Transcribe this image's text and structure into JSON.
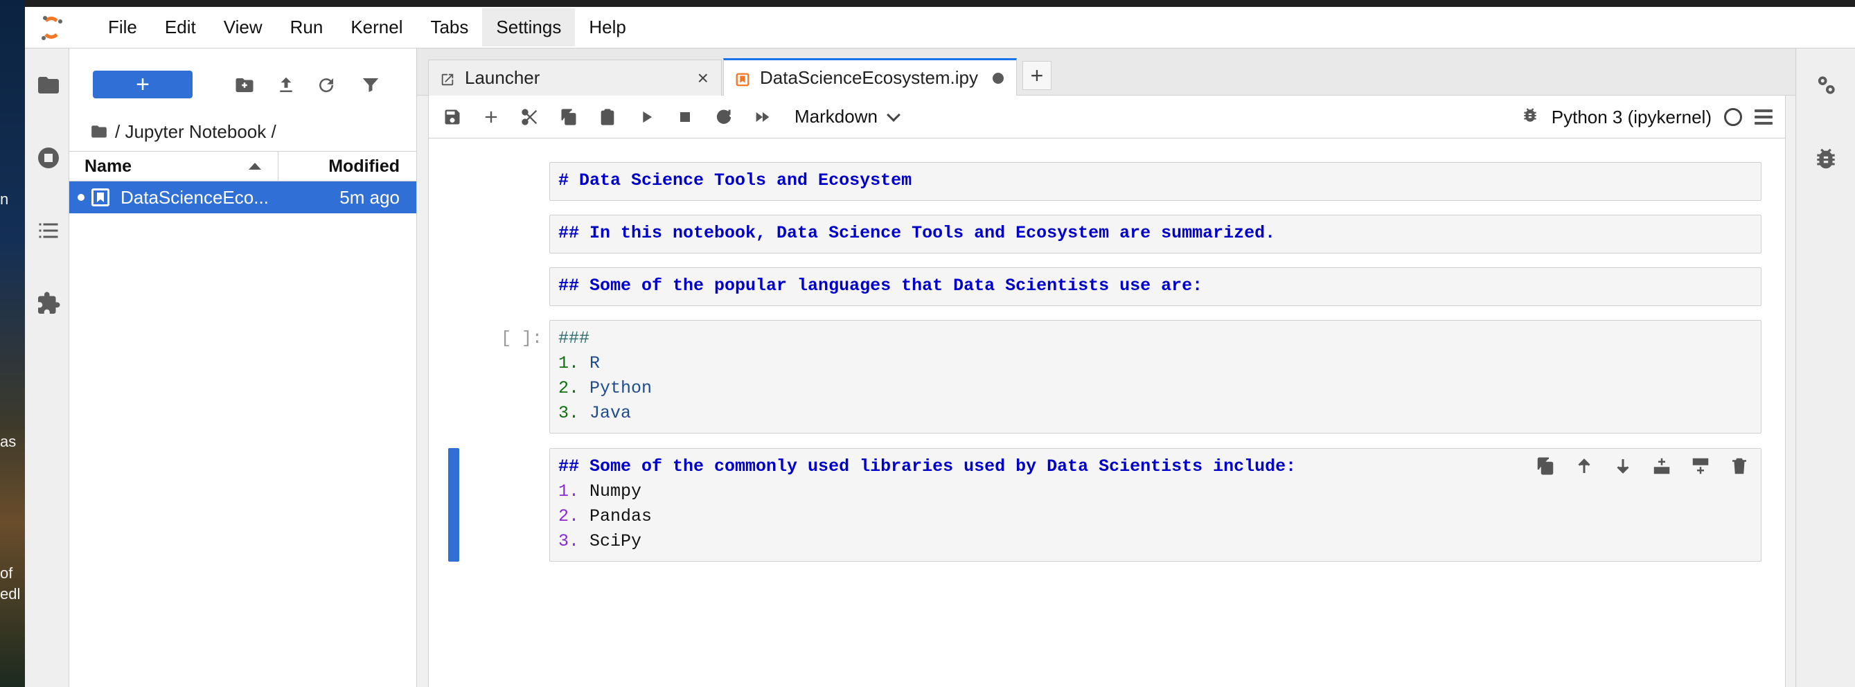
{
  "desktop": {
    "texts": [
      "n",
      "as",
      "of",
      "edl"
    ]
  },
  "menubar": {
    "items": [
      "File",
      "Edit",
      "View",
      "Run",
      "Kernel",
      "Tabs",
      "Settings",
      "Help"
    ],
    "active_item": "Settings"
  },
  "left_sidebar": {
    "icons": [
      "folder-icon",
      "running-icon",
      "table-of-contents-icon",
      "extensions-icon"
    ]
  },
  "filebrowser": {
    "new_button_label": "+",
    "breadcrumb": "/ Jupyter Notebook /",
    "columns": {
      "name": "Name",
      "modified": "Modified"
    },
    "files": [
      {
        "name": "DataScienceEco...",
        "modified": "5m ago",
        "selected": true,
        "running": true
      }
    ]
  },
  "tabs": [
    {
      "label": "Launcher",
      "closable": true
    },
    {
      "label": "DataScienceEcosystem.ipy",
      "dirty": true,
      "active": true
    }
  ],
  "notebook_toolbar": {
    "cell_type": "Markdown",
    "kernel_name": "Python 3 (ipykernel)"
  },
  "cells": [
    {
      "type": "markdown",
      "text": "# Data Science Tools and Ecosystem"
    },
    {
      "type": "markdown",
      "text": "## In this notebook, Data Science Tools and Ecosystem are summarized."
    },
    {
      "type": "markdown",
      "text": "## Some of the popular languages that Data Scientists use are:"
    },
    {
      "type": "code",
      "prompt": "[ ]:",
      "lines": [
        {
          "prefix": "###",
          "text": ""
        },
        {
          "prefix": "1.",
          "text": "R"
        },
        {
          "prefix": "2.",
          "text": "Python"
        },
        {
          "prefix": "3.",
          "text": "Java"
        }
      ]
    },
    {
      "type": "markdown",
      "active": true,
      "header": "## Some of the commonly used libraries used by Data Scientists include:",
      "items": [
        {
          "num": "1.",
          "text": "Numpy"
        },
        {
          "num": "2.",
          "text": "Pandas"
        },
        {
          "num": "3.",
          "text": "SciPy"
        }
      ]
    }
  ],
  "colors": {
    "accent": "#2f6fd6",
    "markdown_heading": "#0000cc",
    "list_number_green": "#107010",
    "list_number_purple": "#8c2ad3"
  }
}
